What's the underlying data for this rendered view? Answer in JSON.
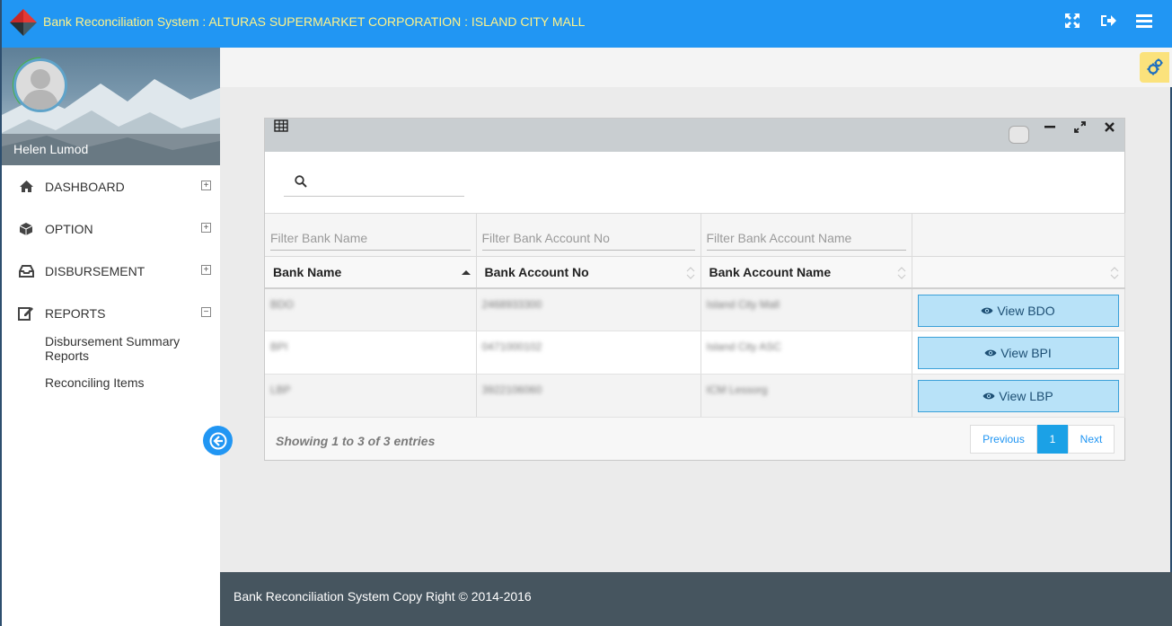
{
  "header": {
    "title": "Bank Reconciliation System : ALTURAS SUPERMARKET CORPORATION : ISLAND CITY MALL",
    "icons": [
      "fullscreen-icon",
      "logout-icon",
      "menu-icon"
    ]
  },
  "sidebar": {
    "user_name": "Helen Lumod",
    "items": [
      {
        "label": "DASHBOARD",
        "icon": "home-icon",
        "expanded": false
      },
      {
        "label": "OPTION",
        "icon": "cube-icon",
        "expanded": false
      },
      {
        "label": "DISBURSEMENT",
        "icon": "inbox-icon",
        "expanded": false
      },
      {
        "label": "REPORTS",
        "icon": "edit-icon",
        "expanded": true
      }
    ],
    "submenu": [
      "Disbursement Summary Reports",
      "Reconciling Items"
    ]
  },
  "panel": {
    "search_placeholder": "",
    "filters": [
      "Filter Bank Name",
      "Filter Bank Account No",
      "Filter Bank Account Name"
    ],
    "columns": [
      "Bank Name",
      "Bank Account No",
      "Bank Account Name",
      ""
    ],
    "rows": [
      {
        "bank_name": "BDO",
        "account_no": "2468933300",
        "account_name": "Island City Mall",
        "action": "View BDO"
      },
      {
        "bank_name": "BPI",
        "account_no": "0471000102",
        "account_name": "Island City ASC",
        "action": "View BPI"
      },
      {
        "bank_name": "LBP",
        "account_no": "3922106060",
        "account_name": "ICM Lessorg",
        "action": "View LBP"
      }
    ],
    "entries_info": "Showing 1 to 3 of 3 entries",
    "pager": {
      "previous": "Previous",
      "current": "1",
      "next": "Next"
    }
  },
  "footer": {
    "text": "Bank Reconciliation System Copy Right © 2014-2016"
  },
  "colors": {
    "header_bg": "#2196f3",
    "title_text": "#fff38a",
    "footer_bg": "#46555f",
    "view_button_bg": "#b8e2f8",
    "pager_active": "#1ba1e6"
  }
}
